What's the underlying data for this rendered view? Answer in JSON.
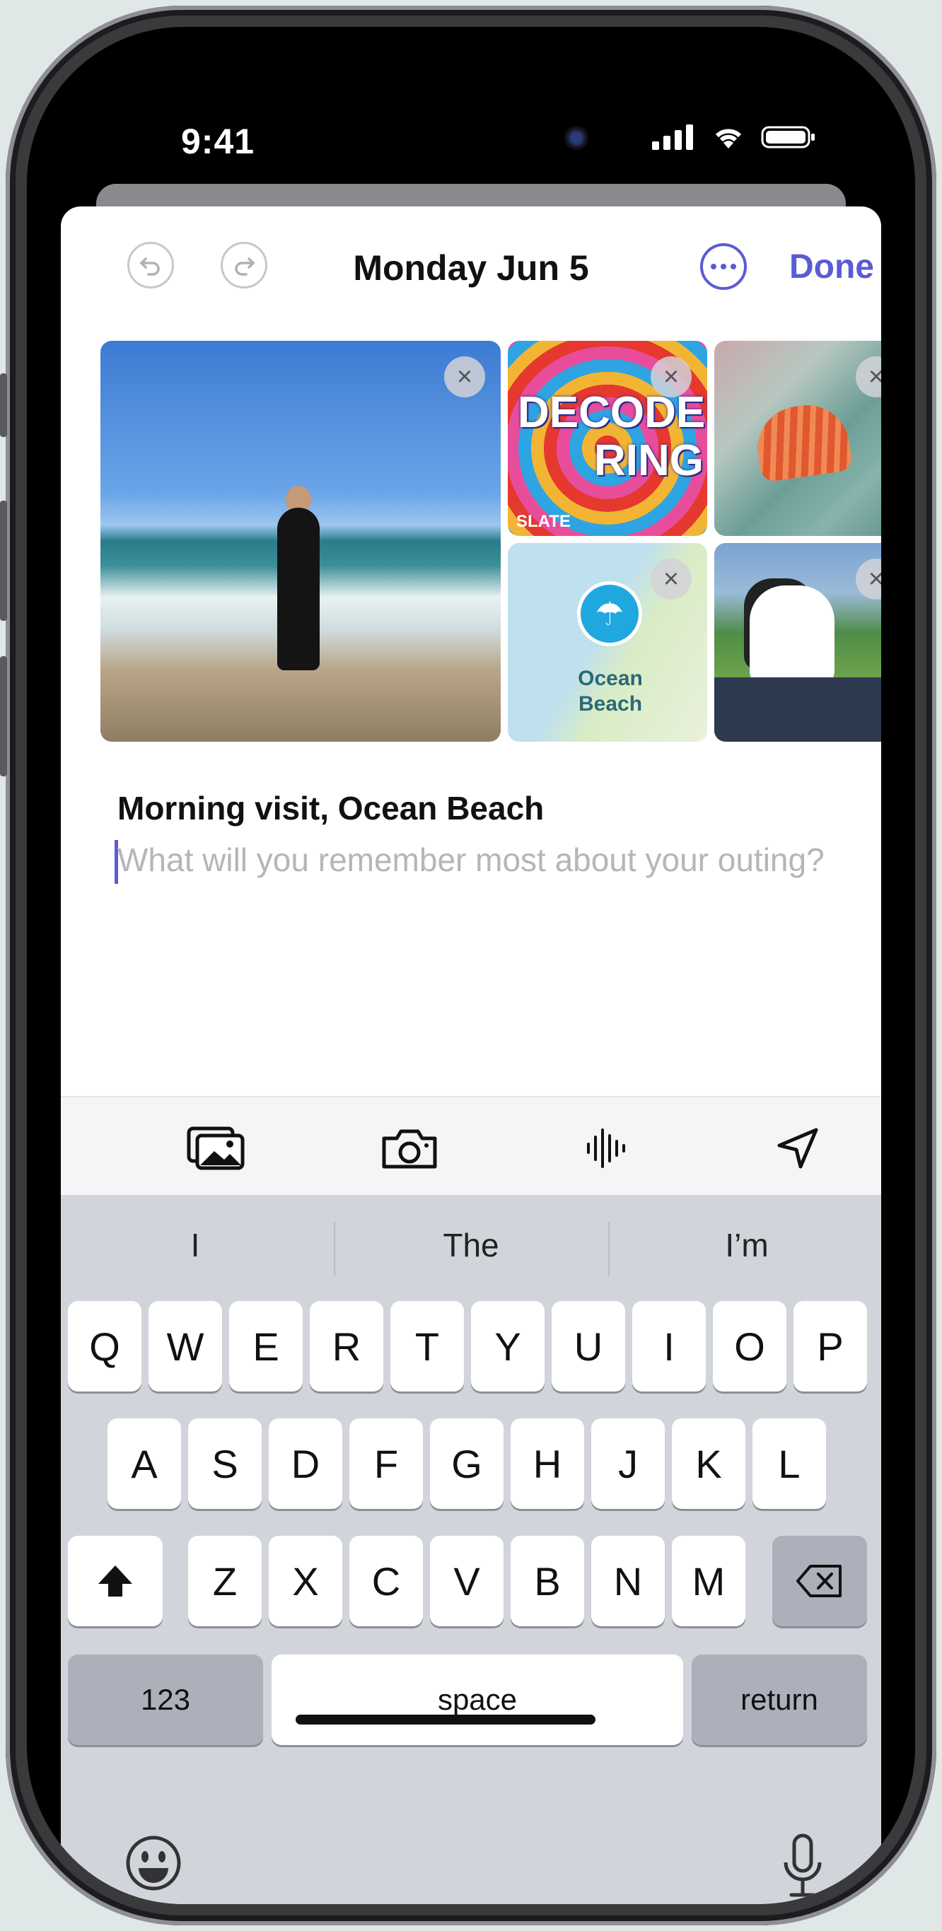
{
  "status_bar": {
    "time": "9:41"
  },
  "navbar": {
    "undo_icon": "undo-arrow-icon",
    "redo_icon": "redo-arrow-icon",
    "title": "Monday Jun 5",
    "more_icon": "ellipsis-circle-icon",
    "done_label": "Done"
  },
  "attachments": {
    "podcast_art_title_line1": "DECODER",
    "podcast_art_title_line2": "RING",
    "podcast_publisher": "SLATE",
    "map_label": "Ocean Beach",
    "remove_label": "×"
  },
  "note": {
    "title": "Morning visit, Ocean Beach",
    "placeholder": "What will you remember most about your outing?"
  },
  "toolbar": {
    "items": [
      "photo-library-icon",
      "camera-icon",
      "audio-waveform-icon",
      "location-arrow-icon"
    ]
  },
  "keyboard": {
    "suggestions": [
      "I",
      "The",
      "I’m"
    ],
    "row1": [
      "Q",
      "W",
      "E",
      "R",
      "T",
      "Y",
      "U",
      "I",
      "O",
      "P"
    ],
    "row2": [
      "A",
      "S",
      "D",
      "F",
      "G",
      "H",
      "J",
      "K",
      "L"
    ],
    "row3": [
      "Z",
      "X",
      "C",
      "V",
      "B",
      "N",
      "M"
    ],
    "numbers_label": "123",
    "space_label": "space",
    "return_label": "return",
    "shift_icon": "shift-arrow-icon",
    "delete_icon": "delete-backspace-icon",
    "emoji_icon": "emoji-smile-icon",
    "mic_icon": "microphone-icon"
  },
  "colors": {
    "accent": "#5b5bd6",
    "keyboard_bg": "#d1d4db"
  }
}
